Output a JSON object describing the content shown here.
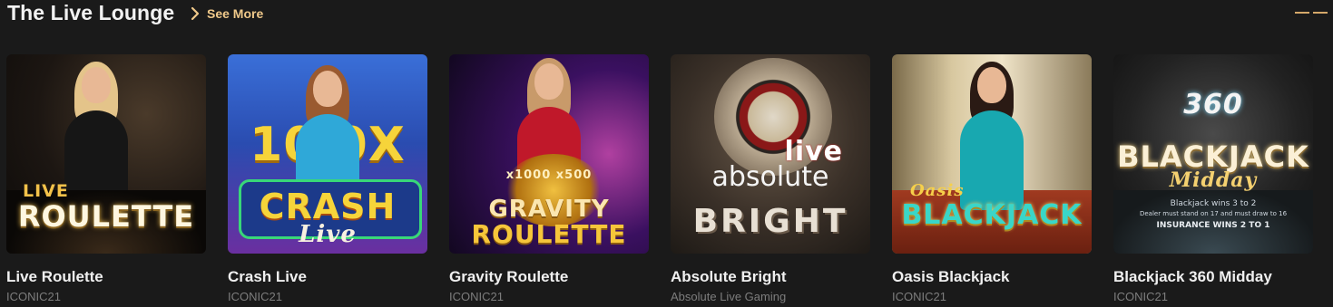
{
  "section": {
    "title": "The Live Lounge",
    "see_more_label": "See More"
  },
  "colors": {
    "background": "#1a1a1a",
    "accent": "#f0c98a",
    "provider_text": "#7d7d7d"
  },
  "icons": {
    "see_more": "chevron-right-icon",
    "pager": "pager-dash-icon"
  },
  "games": [
    {
      "name": "Live Roulette",
      "provider": "ICONIC21",
      "art": {
        "top_text": "LIVE",
        "main_text": "ROULETTE",
        "sub_text": ""
      }
    },
    {
      "name": "Crash Live",
      "provider": "ICONIC21",
      "art": {
        "top_text": "10 0X",
        "main_text": "CRASH",
        "sub_text": "Live"
      }
    },
    {
      "name": "Gravity Roulette",
      "provider": "ICONIC21",
      "art": {
        "top_text": "x1000  x500",
        "main_text": "GRAVITY",
        "sub_text": "ROULETTE"
      }
    },
    {
      "name": "Absolute Bright",
      "provider": "Absolute Live Gaming",
      "art": {
        "top_text": "live",
        "main_text": "absolute",
        "sub_text": "BRIGHT"
      }
    },
    {
      "name": "Oasis Blackjack",
      "provider": "ICONIC21",
      "art": {
        "top_text": "Oasis",
        "main_text": "BLACKJACK",
        "sub_text": ""
      }
    },
    {
      "name": "Blackjack 360 Midday",
      "provider": "ICONIC21",
      "art": {
        "top_text": "360",
        "main_text": "BLACKJACK",
        "sub_text": "Midday",
        "fine_1": "Blackjack wins 3 to 2",
        "fine_2": "Dealer must stand on 17 and must draw to 16",
        "fine_3": "INSURANCE WINS 2 TO 1"
      }
    }
  ]
}
